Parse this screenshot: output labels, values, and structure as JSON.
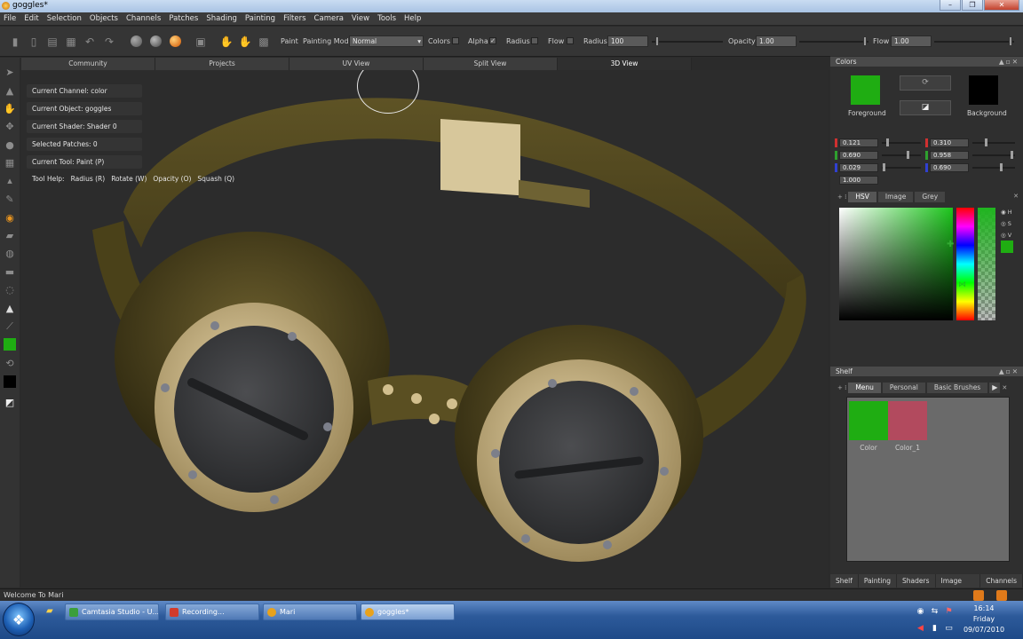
{
  "window": {
    "title": "goggles*"
  },
  "menu": [
    "File",
    "Edit",
    "Selection",
    "Objects",
    "Channels",
    "Patches",
    "Shading",
    "Painting",
    "Filters",
    "Camera",
    "View",
    "Tools",
    "Help"
  ],
  "toolbar": {
    "paint_label": "Paint",
    "painting_mode_label": "Painting Mode",
    "painting_mode_value": "Normal",
    "colors_label": "Colors",
    "alpha_label": "Alpha",
    "radius_label": "Radius",
    "flow_label": "Flow",
    "radius2_label": "Radius",
    "radius_value": "100",
    "opacity_label": "Opacity",
    "opacity_value": "1.00",
    "flow2_label": "Flow",
    "flow_value": "1.00"
  },
  "view_tabs": [
    "Community",
    "Projects",
    "UV View",
    "Split View",
    "3D View"
  ],
  "hud": {
    "channel": "Current Channel: color",
    "object": "Current Object: goggles",
    "shader": "Current Shader: Shader 0",
    "patches": "Selected Patches: 0",
    "tool": "Current Tool: Paint (P)",
    "help_label": "Tool Help:",
    "help_items": [
      "Radius (R)",
      "Rotate (W)",
      "Opacity (O)",
      "Squash (Q)"
    ]
  },
  "colors_panel": {
    "title": "Colors",
    "foreground_label": "Foreground",
    "background_label": "Background",
    "foreground_color": "#1fad12",
    "background_color": "#000000",
    "fg_values": [
      "0.121",
      "0.690",
      "0.029",
      "1.000"
    ],
    "bg_values": [
      "0.310",
      "0.958",
      "0.690"
    ],
    "fg_levels": [
      0.121,
      0.69,
      0.029
    ],
    "bg_levels": [
      0.31,
      0.958,
      0.69
    ],
    "tabs": [
      "HSV",
      "Image",
      "Grey"
    ],
    "hsv_options": [
      "H",
      "S",
      "V"
    ]
  },
  "shelf_panel": {
    "title": "Shelf",
    "tabs": [
      "Menu",
      "Personal",
      "Basic Brushes"
    ],
    "items": [
      {
        "label": "Color",
        "color": "#1fad12"
      },
      {
        "label": "Color_1",
        "color": "#b24a5e"
      }
    ],
    "bottom_tabs": [
      "Shelf",
      "Painting",
      "Shaders",
      "Image Manager",
      "Channels"
    ]
  },
  "status": {
    "message": "Welcome To Mari"
  },
  "taskbar": {
    "buttons": [
      {
        "label": "Camtasia Studio - U...",
        "color": "#3b9e3b"
      },
      {
        "label": "Recording...",
        "color": "#d23b2b"
      },
      {
        "label": "Mari",
        "color": "#e8a21c"
      },
      {
        "label": "goggles*",
        "color": "#e8a21c"
      }
    ],
    "clock_time": "16:14",
    "clock_day": "Friday",
    "clock_date": "09/07/2010"
  }
}
